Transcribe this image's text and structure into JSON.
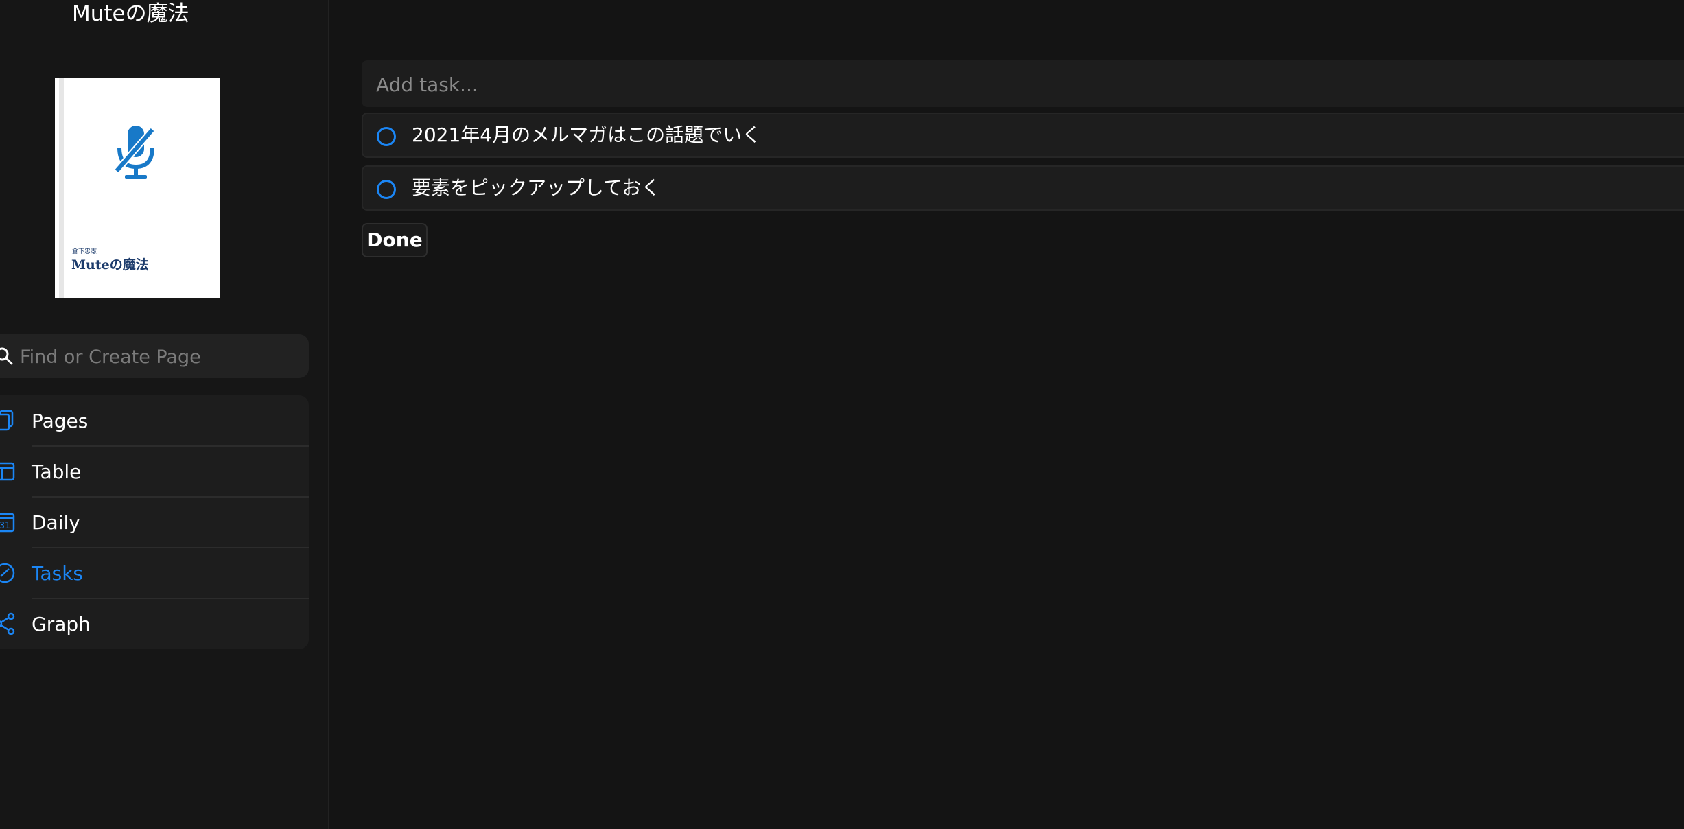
{
  "colors": {
    "accent": "#1b86f5",
    "background": "#141414",
    "sidebar_background": "#161616",
    "panel": "#1d1d1d",
    "cover_title": "#1c3b6b"
  },
  "sidebar": {
    "title": "Muteの魔法",
    "cover": {
      "author": "倉下忠憲",
      "title": "Muteの魔法",
      "icon": "mic-muted-icon"
    },
    "search": {
      "placeholder": "Find or Create Page",
      "value": "",
      "icon": "search-icon"
    },
    "nav": [
      {
        "label": "Pages",
        "icon": "pages-icon",
        "active": false
      },
      {
        "label": "Table",
        "icon": "table-icon",
        "active": false
      },
      {
        "label": "Daily",
        "icon": "calendar-icon",
        "active": false
      },
      {
        "label": "Tasks",
        "icon": "tasks-icon",
        "active": true
      },
      {
        "label": "Graph",
        "icon": "graph-icon",
        "active": false
      }
    ]
  },
  "main": {
    "add_task": {
      "placeholder": "Add task...",
      "value": ""
    },
    "tasks": [
      {
        "text": "2021年4月のメルマガはこの話題でいく",
        "done": false
      },
      {
        "text": "要素をピックアップしておく",
        "done": false
      }
    ],
    "done_label": "Done"
  }
}
